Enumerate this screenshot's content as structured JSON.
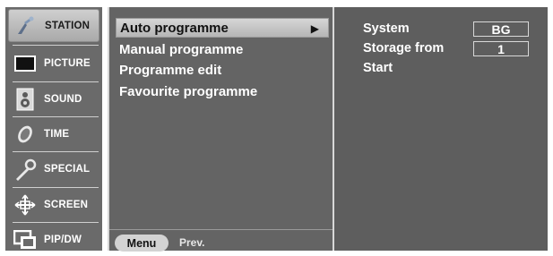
{
  "sidebar": {
    "items": [
      {
        "label": "STATION",
        "icon": "station-icon",
        "active": true
      },
      {
        "label": "PICTURE",
        "icon": "picture-icon",
        "active": false
      },
      {
        "label": "SOUND",
        "icon": "sound-icon",
        "active": false
      },
      {
        "label": "TIME",
        "icon": "time-icon",
        "active": false
      },
      {
        "label": "SPECIAL",
        "icon": "special-icon",
        "active": false
      },
      {
        "label": "SCREEN",
        "icon": "screen-icon",
        "active": false
      },
      {
        "label": "PIP/DW",
        "icon": "pip-dw-icon",
        "active": false
      }
    ]
  },
  "menu": {
    "items": [
      {
        "label": "Auto programme",
        "selected": true,
        "arrow": "▶"
      },
      {
        "label": "Manual programme",
        "selected": false
      },
      {
        "label": "Programme edit",
        "selected": false
      },
      {
        "label": "Favourite programme",
        "selected": false
      }
    ],
    "footer": {
      "menu_label": "Menu",
      "prev_label": "Prev."
    }
  },
  "settings": {
    "system": {
      "label": "System",
      "value": "BG"
    },
    "storage_from": {
      "label": "Storage from",
      "value": "1"
    },
    "start": {
      "label": "Start"
    }
  },
  "colors": {
    "panel_bg": "#646464",
    "highlight": "#c4c4c4",
    "text": "#ffffff"
  }
}
